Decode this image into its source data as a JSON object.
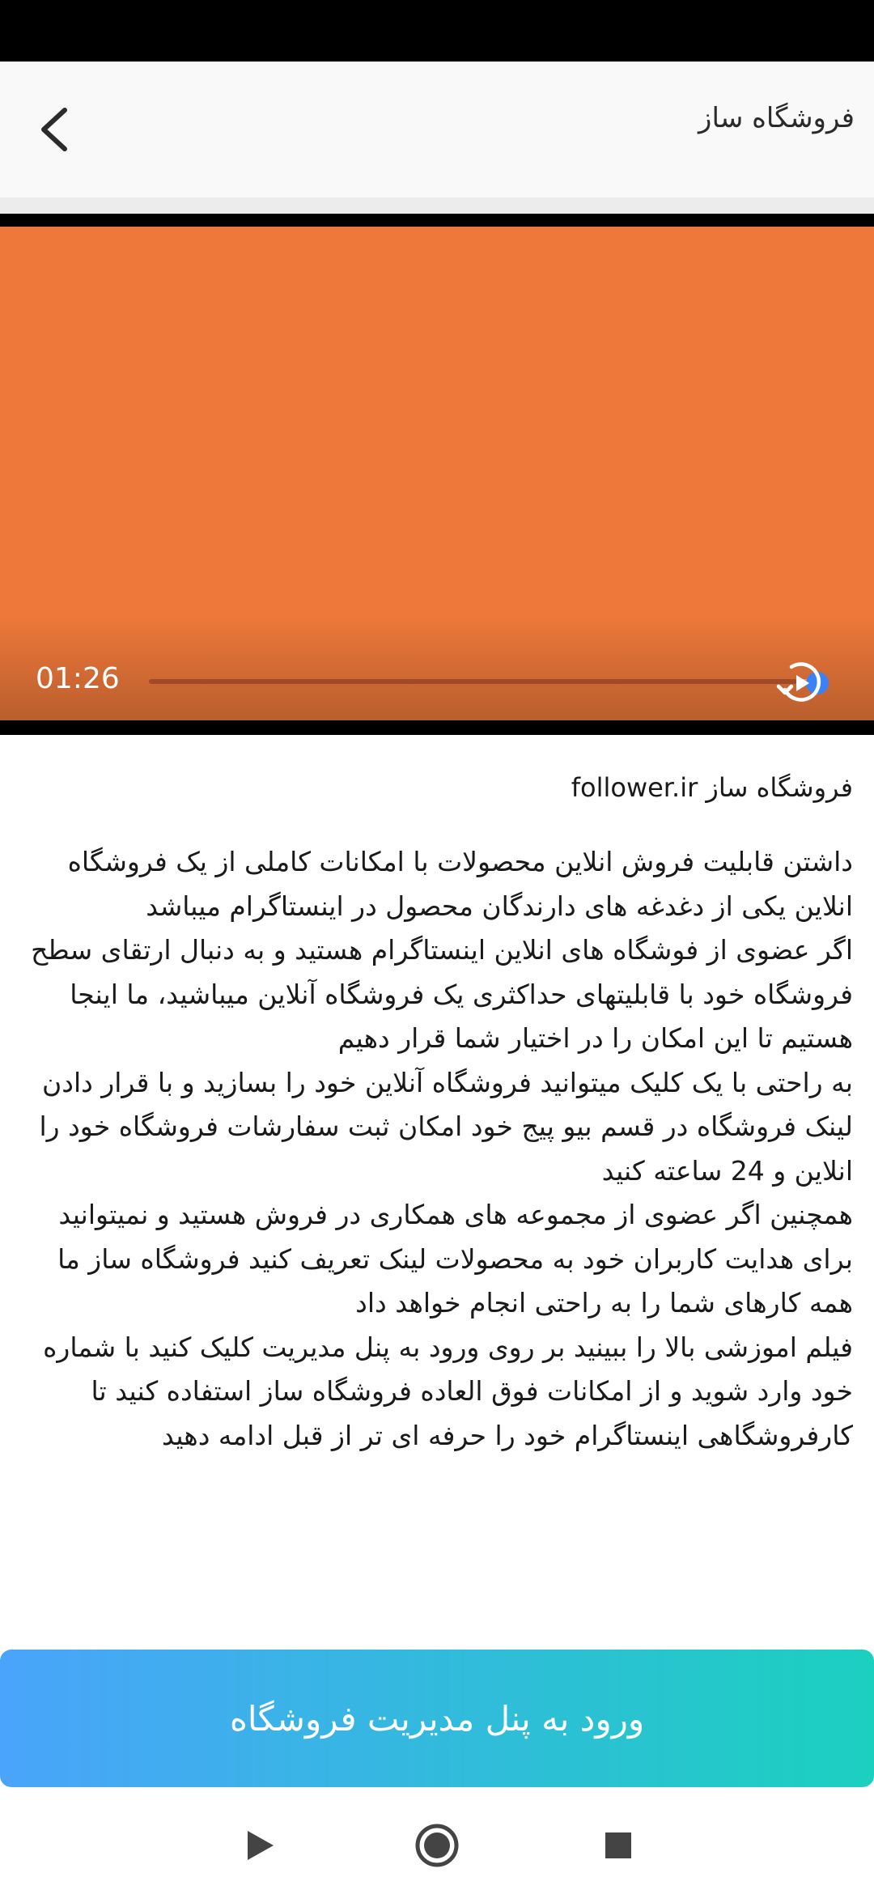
{
  "app_bar": {
    "title": "فروشگاه ساز"
  },
  "video": {
    "time": "01:26",
    "progress": 0.97,
    "background_color": "#ee783a"
  },
  "content": {
    "title": "فروشگاه ساز follower.ir",
    "body": "داشتن قابلیت فروش انلاین محصولات با امکانات کاملی از یک فروشگاه انلاین یکی از دغدغه های دارندگان محصول در اینستاگرام میباشد\nاگر عضوی از فوشگاه های انلاین اینستاگرام هستید و به دنبال ارتقای سطح فروشگاه خود با قابلیتهای حداکثری یک فروشگاه آنلاین میباشید، ما اینجا هستیم تا این امکان را در اختیار شما قرار دهیم\nبه راحتی با یک کلیک میتوانید فروشگاه آنلاین خود را بسازید و با قرار دادن لینک فروشگاه در قسم بیو پیج خود امکان ثبت سفارشات فروشگاه خود را انلاین و 24 ساعته کنید\nهمچنین اگر عضوی از مجموعه های همکاری در فروش هستید و نمیتوانید برای هدایت کاربران خود به محصولات لینک تعریف کنید فروشگاه ساز ما همه کارهای شما را به راحتی انجام خواهد داد\nفیلم اموزشی بالا را ببینید بر روی ورود به پنل مدیریت کلیک کنید با شماره خود وارد شوید و از امکانات فوق العاده فروشگاه ساز استفاده کنید تا کارفروشگاهی اینستاگرام خود را حرفه ای تر از قبل ادامه دهید"
  },
  "cta": {
    "label": "ورود به پنل مدیریت فروشگاه",
    "gradient_start": "#4aa4fb",
    "gradient_end": "#1bd0bf"
  },
  "nav_bar": {
    "icons": [
      "back-triangle-icon",
      "home-circle-icon",
      "recents-square-icon"
    ]
  }
}
